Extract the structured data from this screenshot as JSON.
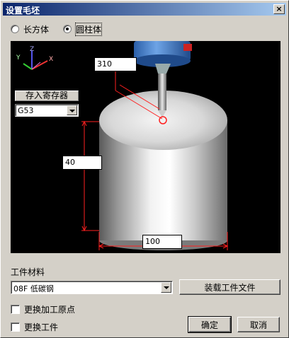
{
  "window": {
    "title": "设置毛坯",
    "close_glyph": "×"
  },
  "shape": {
    "options": [
      {
        "label": "长方体",
        "checked": false
      },
      {
        "label": "圆柱体",
        "checked": true
      }
    ]
  },
  "viewport": {
    "axes": {
      "x": "X",
      "y": "Y",
      "z": "Z"
    },
    "register_label": "存入寄存器",
    "register_value": "G53",
    "dims": {
      "z_offset": "310",
      "height": "40",
      "diameter": "100"
    }
  },
  "material": {
    "label": "工件材料",
    "value": "08F 低碳钢",
    "load_button": "装载工件文件"
  },
  "options": {
    "change_origin": "更换加工原点",
    "change_workpiece": "更换工件"
  },
  "buttons": {
    "ok": "确定",
    "cancel": "取消"
  }
}
